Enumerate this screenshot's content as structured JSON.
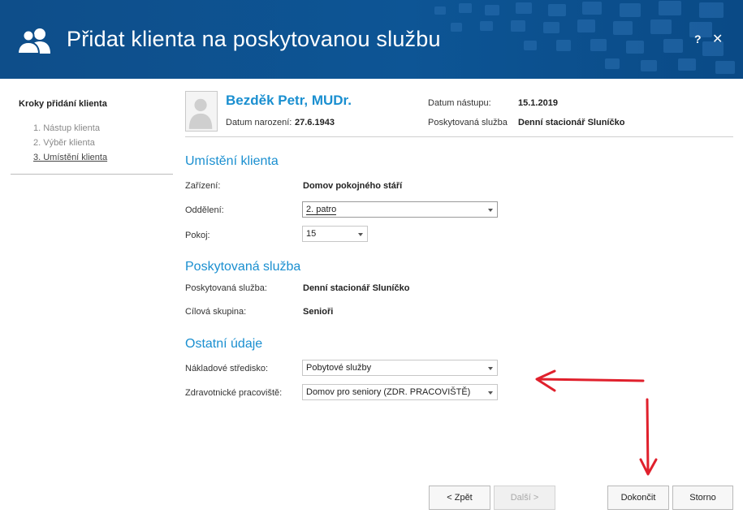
{
  "window": {
    "title": "Přidat klienta na poskytovanou službu",
    "help_label": "?",
    "close_label": "✕"
  },
  "sidebar": {
    "title": "Kroky přidání klienta",
    "steps": [
      {
        "label": "1. Nástup klienta"
      },
      {
        "label": "2. Výběr klienta"
      },
      {
        "label": "3. Umístění klienta"
      }
    ]
  },
  "client": {
    "name": "Bezděk Petr, MUDr.",
    "birth_label": "Datum narození:",
    "birth_value": "27.6.1943",
    "start_label": "Datum nástupu:",
    "start_value": "15.1.2019",
    "service_label": "Poskytovaná služba",
    "service_value": "Denní stacionář Sluníčko"
  },
  "placement": {
    "title": "Umístění klienta",
    "facility_label": "Zařízení:",
    "facility_value": "Domov pokojného stáří",
    "department_label": "Oddělení:",
    "department_value": "2. patro",
    "room_label": "Pokoj:",
    "room_value": "15"
  },
  "service": {
    "title": "Poskytovaná služba",
    "service_label": "Poskytovaná služba:",
    "service_value": "Denní stacionář Sluníčko",
    "target_label": "Cílová skupina:",
    "target_value": "Senioři"
  },
  "other": {
    "title": "Ostatní údaje",
    "cost_center_label": "Nákladové středisko:",
    "cost_center_value": "Pobytové služby",
    "health_label": "Zdravotnické pracoviště:",
    "health_value": "Domov pro seniory (ZDR. PRACOVIŠTĚ)"
  },
  "buttons": {
    "back": "< Zpět",
    "next": "Další >",
    "finish": "Dokončit",
    "cancel": "Storno"
  },
  "colors": {
    "header": "#0d5595",
    "accent": "#1a8fd0",
    "annotation_arrow": "#e0202c"
  },
  "icons": {
    "title": "users-icon",
    "avatar": "person-placeholder-icon"
  }
}
